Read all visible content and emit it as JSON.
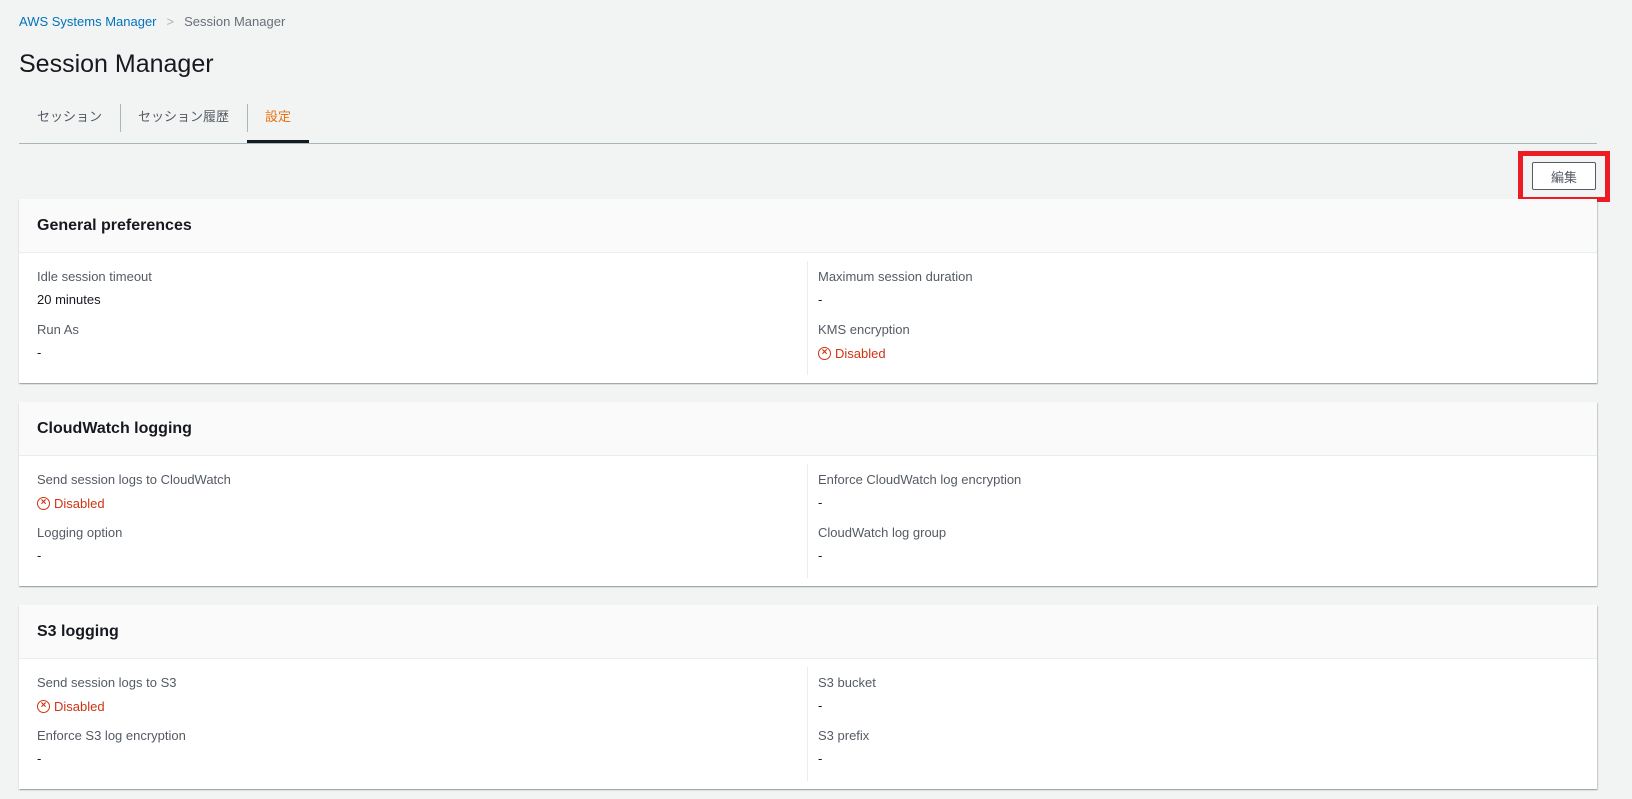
{
  "breadcrumb": {
    "parent": "AWS Systems Manager",
    "current": "Session Manager"
  },
  "title": "Session Manager",
  "tabs": [
    {
      "label": "セッション"
    },
    {
      "label": "セッション履歴"
    },
    {
      "label": "設定"
    }
  ],
  "edit_label": "編集",
  "panels": [
    {
      "title": "General preferences",
      "fields": [
        {
          "label": "Idle session timeout",
          "value": "20 minutes"
        },
        {
          "label": "Maximum session duration",
          "value": "-"
        },
        {
          "label": "Run As",
          "value": "-"
        },
        {
          "label": "KMS encryption",
          "value": "Disabled"
        }
      ]
    },
    {
      "title": "CloudWatch logging",
      "fields": [
        {
          "label": "Send session logs to CloudWatch",
          "value": "Disabled"
        },
        {
          "label": "Enforce CloudWatch log encryption",
          "value": "-"
        },
        {
          "label": "Logging option",
          "value": "-"
        },
        {
          "label": "CloudWatch log group",
          "value": "-"
        }
      ]
    },
    {
      "title": "S3 logging",
      "fields": [
        {
          "label": "Send session logs to S3",
          "value": "Disabled"
        },
        {
          "label": "S3 bucket",
          "value": "-"
        },
        {
          "label": "Enforce S3 log encryption",
          "value": "-"
        },
        {
          "label": "S3 prefix",
          "value": "-"
        }
      ]
    }
  ],
  "colors": {
    "disabled": "#d13212",
    "active_tab": "#ec7211",
    "link": "#0073bb"
  }
}
